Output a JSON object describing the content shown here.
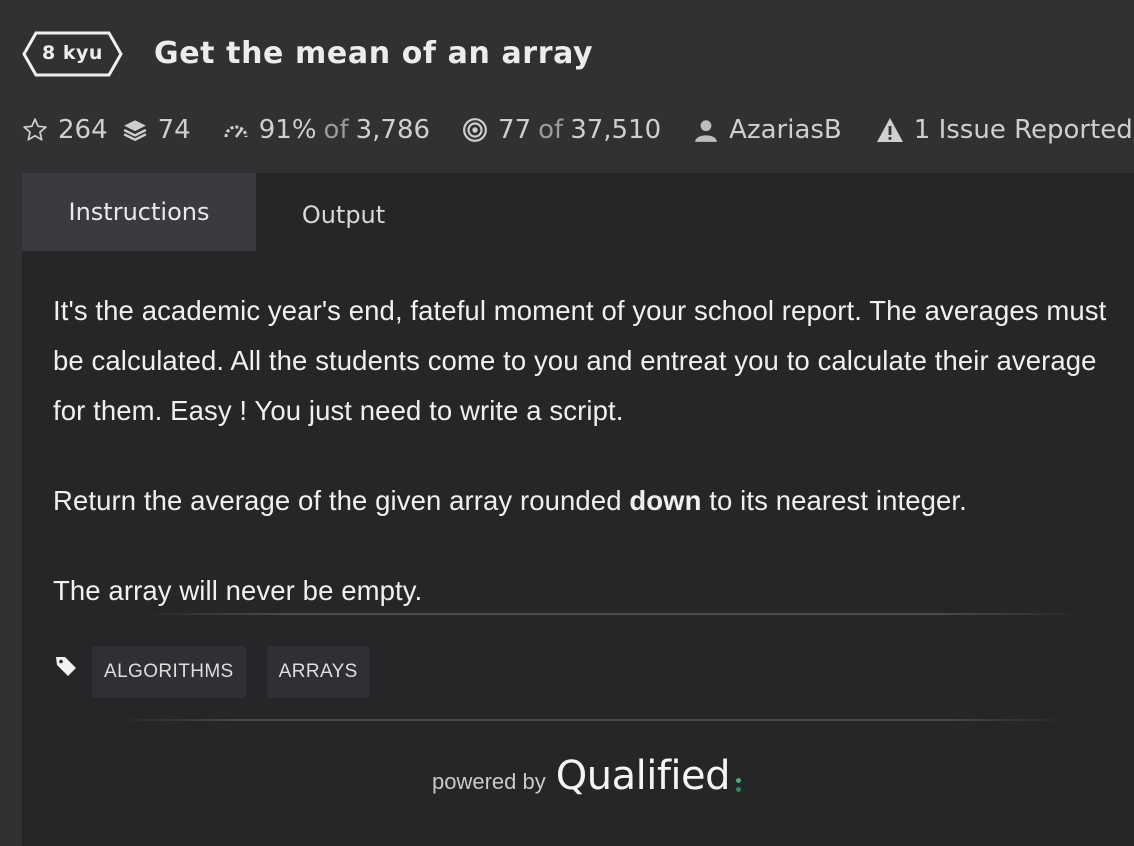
{
  "header": {
    "rank_label": "8 kyu",
    "title": "Get the mean of an array"
  },
  "stats": {
    "stars": "264",
    "collections": "74",
    "satisfaction_percent": "91%",
    "satisfaction_of": "of",
    "satisfaction_votes": "3,786",
    "completed": "77",
    "completed_of": "of",
    "completed_total": "37,510",
    "author": "AzariasB",
    "issues": "1 Issue Reported"
  },
  "tabs": {
    "instructions": "Instructions",
    "output": "Output"
  },
  "description": {
    "paragraph1": "It's the academic year's end, fateful moment of your school report. The averages must be calculated. All the students come to you and entreat you to calculate their average for them. Easy ! You just need to write a script.",
    "paragraph2_before": "Return the average of the given array rounded ",
    "paragraph2_bold": "down",
    "paragraph2_after": " to its nearest integer.",
    "paragraph3": "The array will never be empty."
  },
  "tags": [
    "ALGORITHMS",
    "ARRAYS"
  ],
  "footer": {
    "powered_by": "powered by",
    "brand": "Qualified"
  },
  "icons": {
    "rank": "hexagon-badge",
    "stars": "star-outline-icon",
    "collections": "layers-icon",
    "satisfaction": "gauge-icon",
    "completed": "target-icon",
    "author": "user-icon",
    "issues": "warning-triangle-icon",
    "tags": "tag-icon"
  },
  "colors": {
    "background": "#303133",
    "panel": "#252628",
    "active_tab": "#3a3b3e",
    "brand_dot_top": "#4caf7a",
    "brand_dot_bottom": "#2e8b57"
  }
}
